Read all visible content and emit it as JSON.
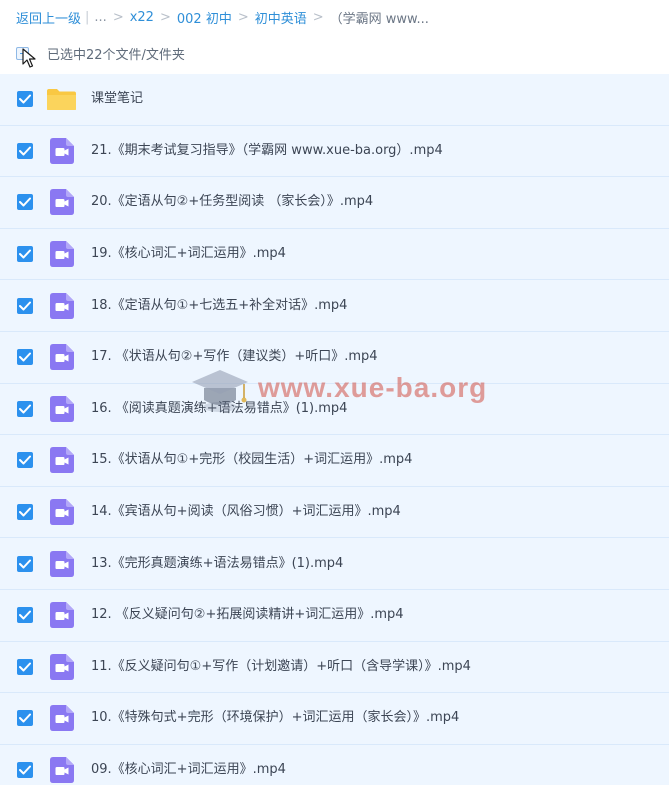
{
  "breadcrumb": {
    "back": "返回上一级",
    "ellipsis": "...",
    "items": [
      "x22",
      "002 初中",
      "初中英语"
    ],
    "current": "（学霸网 www..."
  },
  "selection": {
    "summary": "已选中22个文件/文件夹"
  },
  "files": [
    {
      "type": "folder",
      "name": "课堂笔记",
      "checked": true
    },
    {
      "type": "video",
      "name": "21.《期末考试复习指导》（学霸网 www.xue-ba.org）.mp4",
      "checked": true
    },
    {
      "type": "video",
      "name": "20.《定语从句②+任务型阅读 （家长会）》.mp4",
      "checked": true
    },
    {
      "type": "video",
      "name": "19.《核心词汇+词汇运用》.mp4",
      "checked": true
    },
    {
      "type": "video",
      "name": "18.《定语从句①+七选五+补全对话》.mp4",
      "checked": true
    },
    {
      "type": "video",
      "name": "17. 《状语从句②+写作（建议类）+听口》.mp4",
      "checked": true
    },
    {
      "type": "video",
      "name": "16. 《阅读真题演练+语法易错点》(1).mp4",
      "checked": true
    },
    {
      "type": "video",
      "name": "15.《状语从句①+完形（校园生活）+词汇运用》.mp4",
      "checked": true
    },
    {
      "type": "video",
      "name": "14.《宾语从句+阅读（风俗习惯）+词汇运用》.mp4",
      "checked": true
    },
    {
      "type": "video",
      "name": "13.《完形真题演练+语法易错点》(1).mp4",
      "checked": true
    },
    {
      "type": "video",
      "name": "12. 《反义疑问句②+拓展阅读精讲+词汇运用》.mp4",
      "checked": true
    },
    {
      "type": "video",
      "name": "11.《反义疑问句①+写作（计划邀请）+听口（含导学课）》.mp4",
      "checked": true
    },
    {
      "type": "video",
      "name": "10.《特殊句式+完形（环境保护）+词汇运用（家长会）》.mp4",
      "checked": true
    },
    {
      "type": "video",
      "name": "09.《核心词汇+词汇运用》.mp4",
      "checked": true
    }
  ],
  "watermark": {
    "text": "www.xue-ba.org"
  },
  "colors": {
    "accent": "#2c91ee",
    "link": "#2f8fd8",
    "row_selected_bg": "#eef6ff",
    "video_icon": "#8a78f2",
    "folder_icon": "#f9c843"
  },
  "icons": {
    "folder": "folder-icon",
    "video": "video-file-icon",
    "check": "checkbox-checked-icon",
    "cursor": "mouse-cursor-icon"
  }
}
